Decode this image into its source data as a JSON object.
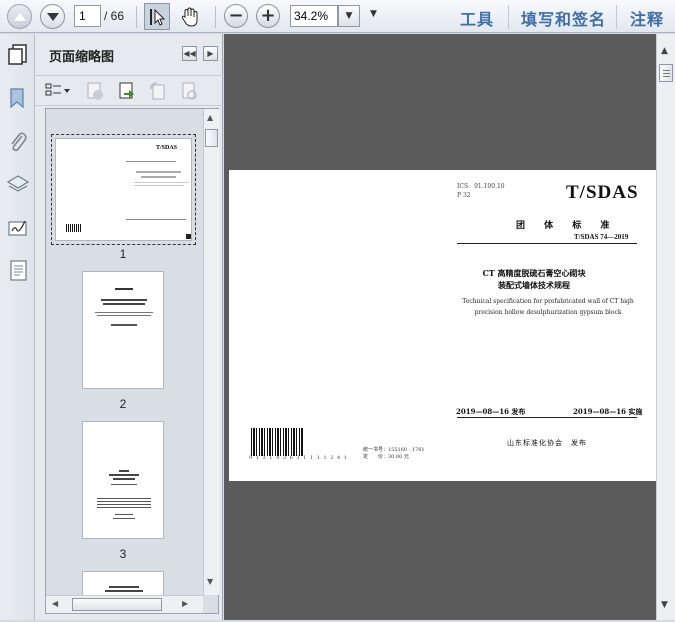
{
  "toolbar": {
    "current_page": "1",
    "total_pages": "/ 66",
    "zoom": "34.2%",
    "menu_tools": "工具",
    "menu_sign": "填写和签名",
    "menu_comment": "注释"
  },
  "sidebar": {
    "panel_title": "页面缩略图",
    "thumbnails": [
      {
        "number": "1"
      },
      {
        "number": "2"
      },
      {
        "number": "3"
      }
    ]
  },
  "document": {
    "ics_line1": "ICS　91.100.10",
    "ics_line2": "P 32",
    "logo": "T/SDAS",
    "standard_type": "团 体 标 准",
    "standard_number": "T/SDAS 74—2019",
    "title_cn_line1": "CT 高精度脱硫石膏空心砌块",
    "title_cn_line2": "装配式墙体技术规程",
    "title_en_line1": "Technical specification for prefabricated wall of CT high",
    "title_en_line2": "precision hollow desulphurization gypsum block",
    "publish_date": "2019—08—16 发布",
    "implement_date": "2019—08—16 实施",
    "barcode_digits": "9 1 3 1 4 3 6 3 1 1 1 1 2 4 1",
    "book_no_line1": "统一书号：155160 · 1761",
    "book_no_line2": "定　　价：30.00 元",
    "publisher": "山东标准化协会　发布"
  }
}
